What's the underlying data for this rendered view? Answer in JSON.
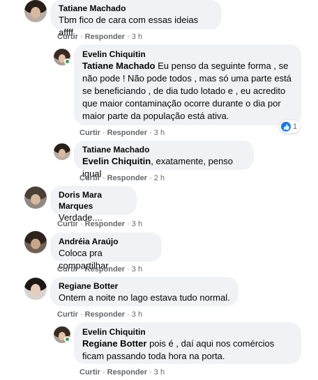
{
  "colors": {
    "bubble": "#f0f2f5",
    "secondary_text": "#65676b",
    "like_blue": "#1877f2",
    "online_green": "#31a24c"
  },
  "comments": [
    {
      "author": "Tatiane Machado",
      "text": "Tbm fico de cara com essas ideias affff",
      "reply": "Responder",
      "like": "Curtir",
      "time": "3 h"
    },
    {
      "author": "Evelin Chiquitin",
      "mention": "Tatiane Machado",
      "text": " Eu penso da seguinte forma , se não pode ! Não pode todos , mas só uma parte está se beneficiando , de dia tudo lotado e , eu acredito que maior contaminação ocorre durante o dia por maior parte da população está ativa.",
      "reply": "Responder",
      "like": "Curtir",
      "time": "3 h",
      "reaction_count": "1",
      "reaction_icon": "like-icon"
    },
    {
      "author": "Tatiane Machado",
      "mention": "Evelin Chiquitin",
      "text": ", exatamente, penso igual",
      "reply": "Responder",
      "like": "Curtir",
      "time": "2 h"
    },
    {
      "author": "Doris Mara Marques",
      "text": "Verdade....",
      "reply": "Responder",
      "like": "Curtir",
      "time": "3 h"
    },
    {
      "author": "Andréia Araújo",
      "text": "Coloca pra compartilhar",
      "reply": "Responder",
      "like": "Curtir",
      "time": "3 h"
    },
    {
      "author": "Regiane Botter",
      "text": "Ontem a noite no lago estava tudo normal.",
      "reply": "Responder",
      "like": "Curtir",
      "time": "3 h"
    },
    {
      "author": "Evelin Chiquitin",
      "mention": "Regiane Botter",
      "text": " pois é , daí aqui nos comércios ficam passando toda hora na porta.",
      "reply": "Responder",
      "like": "Curtir",
      "time": "3 h"
    }
  ]
}
